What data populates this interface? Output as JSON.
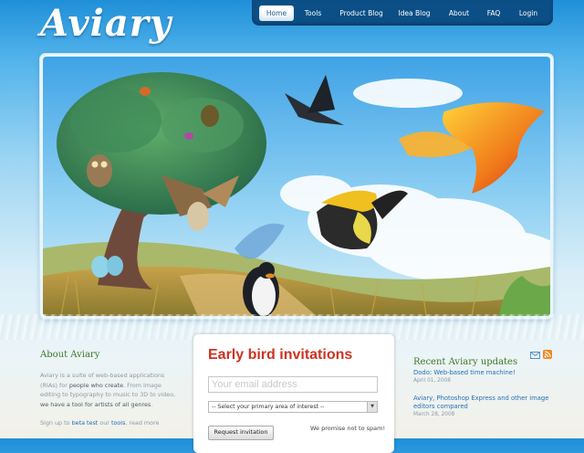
{
  "brand": {
    "logo_text": "Aviary"
  },
  "nav": {
    "items": [
      {
        "label": "Home",
        "active": true
      },
      {
        "label": "Tools"
      },
      {
        "label": "Product Blog"
      },
      {
        "label": "Idea Blog"
      },
      {
        "label": "About"
      },
      {
        "label": "FAQ"
      },
      {
        "label": "Login"
      }
    ]
  },
  "about": {
    "title": "About Aviary",
    "line1": "Aviary is a suite of web-based applications",
    "line2_a": "(RIAs) for",
    "line2_b": "people who create",
    "line2_c": ". From image",
    "line3": "editing to typography to music to 3D to video,",
    "line4_b": "we have a tool for artists of all genres",
    "line4_c": ".",
    "line5_a": "Sign up to",
    "line5_link1": "beta test",
    "line5_b": "our",
    "line5_link2": "tools",
    "line5_c": ", read more"
  },
  "invite": {
    "title": "Early bird invitations",
    "email_placeholder": "Your email address",
    "select_value": "-- Select your primary area of interest --",
    "button_label": "Request invitation",
    "promise": "We promise not to spam!"
  },
  "updates": {
    "title": "Recent Aviary updates",
    "items": [
      {
        "title": "Dodo: Web-based time machine!",
        "date": "April 01, 2008"
      },
      {
        "title": "Aviary, Photoshop Express and other image editors compared",
        "date": "March 28, 2008"
      }
    ]
  },
  "icons": {
    "email": "email-icon",
    "rss": "rss-icon"
  },
  "colors": {
    "nav_bg": "#0b4f86",
    "accent_red": "#cc3320",
    "link_blue": "#1f6fb5",
    "title_green": "#3e7a2a"
  }
}
